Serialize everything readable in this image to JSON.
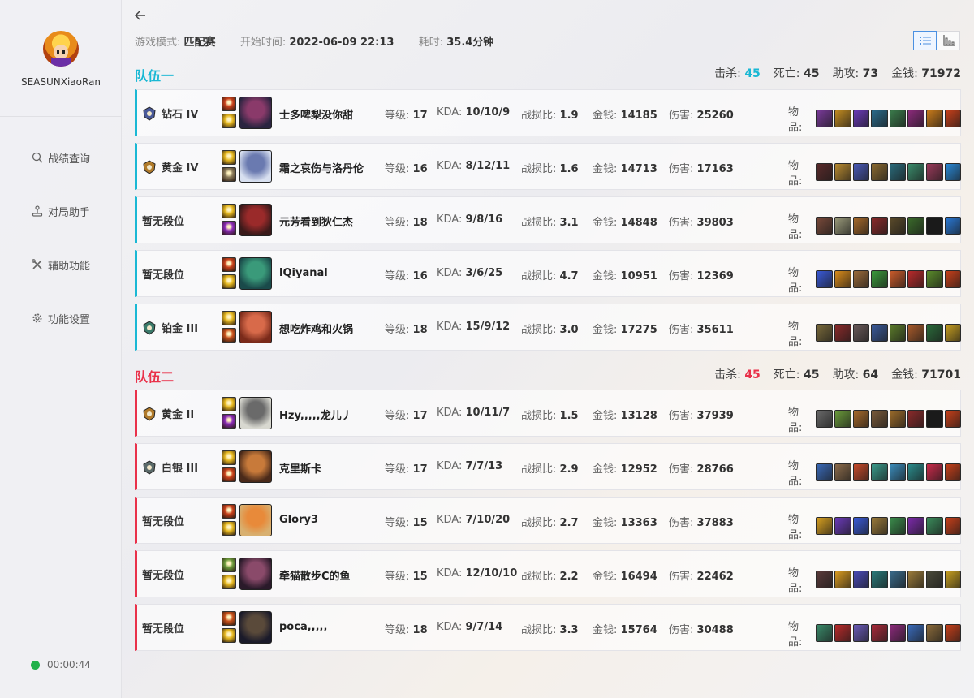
{
  "sidebar": {
    "username": "SEASUNXiaoRan",
    "nav": [
      {
        "label": "战绩查询",
        "icon": "search-icon"
      },
      {
        "label": "对局助手",
        "icon": "joystick-icon"
      },
      {
        "label": "辅助功能",
        "icon": "tools-icon"
      },
      {
        "label": "功能设置",
        "icon": "gear-icon"
      }
    ],
    "timer": "00:00:44",
    "status_color": "#21b14a"
  },
  "header": {
    "mode_label": "游戏模式:",
    "mode": "匹配赛",
    "start_label": "开始时间:",
    "start": "2022-06-09 22:13",
    "duration_label": "耗时:",
    "duration": "35.4分钟"
  },
  "labels": {
    "kills": "击杀:",
    "deaths": "死亡:",
    "assists": "助攻:",
    "gold": "金钱:",
    "level": "等级:",
    "kda": "KDA:",
    "ratio": "战损比:",
    "damage": "伤害:",
    "items": "物品:"
  },
  "colors": {
    "team1_accent": "#1ab8d4",
    "team2_accent": "#e9314a"
  },
  "teams": [
    {
      "title": "队伍一",
      "kills": "45",
      "deaths": "45",
      "assists": "73",
      "gold": "71972",
      "players": [
        {
          "rank": "钻石 IV",
          "emblem": "diamond-emblem",
          "name": "士多啤梨没你甜",
          "level": "17",
          "kda": "10/10/9",
          "ratio": "1.9",
          "gold": "14185",
          "damage": "25260",
          "spells": [
            "#c8401a",
            "#e6b820"
          ],
          "champ": [
            "#2a2440",
            "#8a3a6a"
          ],
          "items": [
            "#7a3a9a",
            "#c08a20",
            "#6a3ab8",
            "#2a6a8a",
            "#3a7a4a",
            "#8a2a7a",
            "#c87a1a",
            "#c8401a"
          ]
        },
        {
          "rank": "黄金 IV",
          "emblem": "gold-emblem",
          "name": "霜之哀伤与洛丹伦",
          "level": "16",
          "kda": "8/12/11",
          "ratio": "1.6",
          "gold": "14713",
          "damage": "17163",
          "spells": [
            "#e6b820",
            "#8a7a5a"
          ],
          "champ": [
            "#d8e0f0",
            "#6a7ab0"
          ],
          "items": [
            "#5a2a2a",
            "#b88a30",
            "#4a5ab8",
            "#8a6a30",
            "#2a6a7a",
            "#3a8a6a",
            "#9a3a5a",
            "#2a8ad8"
          ]
        },
        {
          "rank": "暂无段位",
          "emblem": "",
          "name": "元芳看到狄仁杰",
          "level": "18",
          "kda": "9/8/16",
          "ratio": "3.1",
          "gold": "14848",
          "damage": "39803",
          "spells": [
            "#e6b820",
            "#8a2ab8"
          ],
          "champ": [
            "#3a1a1a",
            "#9a2a2a"
          ],
          "items": [
            "#7a4a3a",
            "#9a9a7a",
            "#a86a2a",
            "#8a2a2a",
            "#5a4a2a",
            "#3a6a2a",
            "#1a1a1a",
            "#2a7ad8"
          ]
        },
        {
          "rank": "暂无段位",
          "emblem": "",
          "name": "lQiyanal",
          "level": "16",
          "kda": "3/6/25",
          "ratio": "4.7",
          "gold": "10951",
          "damage": "12369",
          "spells": [
            "#c8401a",
            "#e6b820"
          ],
          "champ": [
            "#1a4a4a",
            "#3a9a7a"
          ],
          "items": [
            "#3a5ad8",
            "#d88a1a",
            "#9a6a3a",
            "#3a9a3a",
            "#c85a2a",
            "#b82a2a",
            "#5a8a2a",
            "#c8401a"
          ]
        },
        {
          "rank": "铂金 III",
          "emblem": "plat-emblem",
          "name": "想吃炸鸡和火锅",
          "level": "18",
          "kda": "15/9/12",
          "ratio": "3.0",
          "gold": "17275",
          "damage": "35611",
          "spells": [
            "#e6b820",
            "#c8501a"
          ],
          "champ": [
            "#7a2a1a",
            "#d86a4a"
          ],
          "items": [
            "#7a6a3a",
            "#8a2a2a",
            "#6a5a5a",
            "#3a5a9a",
            "#5a7a2a",
            "#a85a2a",
            "#2a6a3a",
            "#c8a020"
          ]
        }
      ]
    },
    {
      "title": "队伍二",
      "kills": "45",
      "deaths": "45",
      "assists": "64",
      "gold": "71701",
      "players": [
        {
          "rank": "黄金 II",
          "emblem": "gold-emblem",
          "name": "Hzy,,,,,龙儿丿",
          "level": "17",
          "kda": "10/11/7",
          "ratio": "1.5",
          "gold": "13128",
          "damage": "37939",
          "spells": [
            "#e6b820",
            "#8a2ab8"
          ],
          "champ": [
            "#d8d8d0",
            "#6a6a6a"
          ],
          "items": [
            "#6a6a6a",
            "#6a9a3a",
            "#a86a2a",
            "#7a5a3a",
            "#9a6a2a",
            "#8a2a2a",
            "#1a1a1a",
            "#c8401a"
          ]
        },
        {
          "rank": "白银 III",
          "emblem": "silver-emblem",
          "name": "克里斯卡",
          "level": "17",
          "kda": "7/7/13",
          "ratio": "2.9",
          "gold": "12952",
          "damage": "28766",
          "spells": [
            "#e6b820",
            "#c8401a"
          ],
          "champ": [
            "#4a2a1a",
            "#c87a3a"
          ],
          "items": [
            "#3a6ab8",
            "#8a6a4a",
            "#c84a2a",
            "#3a9a8a",
            "#3a8ab8",
            "#2a8a8a",
            "#c82a4a",
            "#c8401a"
          ]
        },
        {
          "rank": "暂无段位",
          "emblem": "",
          "name": "Glory3",
          "level": "15",
          "kda": "7/10/20",
          "ratio": "2.7",
          "gold": "13363",
          "damage": "37883",
          "spells": [
            "#c8401a",
            "#e6b820"
          ],
          "champ": [
            "#d8b070",
            "#e88a3a"
          ],
          "items": [
            "#d8a020",
            "#6a3ab8",
            "#3a5ad8",
            "#9a7a3a",
            "#3a8a4a",
            "#7a2aa8",
            "#3a8a5a",
            "#c8401a"
          ]
        },
        {
          "rank": "暂无段位",
          "emblem": "",
          "name": "牵猫散步C的鱼",
          "level": "15",
          "kda": "12/10/10",
          "ratio": "2.2",
          "gold": "16494",
          "damage": "22462",
          "spells": [
            "#6a9a3a",
            "#e6b820"
          ],
          "champ": [
            "#2a1a2a",
            "#8a4a6a"
          ],
          "items": [
            "#5a3a3a",
            "#d89a20",
            "#4a4ab8",
            "#2a7a7a",
            "#3a6a8a",
            "#9a7a3a",
            "#4a4a3a",
            "#c8a020"
          ]
        },
        {
          "rank": "暂无段位",
          "emblem": "",
          "name": "poca,,,,,",
          "level": "18",
          "kda": "9/7/14",
          "ratio": "3.3",
          "gold": "15764",
          "damage": "30488",
          "spells": [
            "#c8501a",
            "#e6b820"
          ],
          "champ": [
            "#1a1a2a",
            "#5a4a3a"
          ],
          "items": [
            "#3a8a6a",
            "#b82a2a",
            "#6a5ab8",
            "#a82a3a",
            "#8a2a7a",
            "#3a6ab8",
            "#8a6a3a",
            "#c8401a"
          ]
        }
      ]
    }
  ]
}
